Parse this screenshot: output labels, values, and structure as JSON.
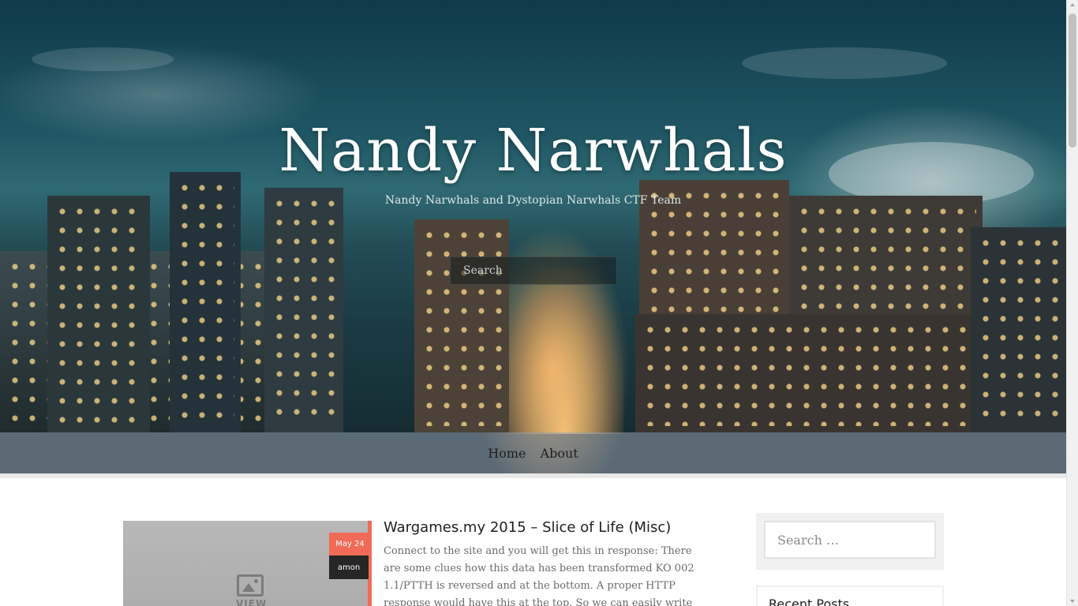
{
  "site": {
    "title": "Nandy Narwhals",
    "tagline": "Nandy Narwhals and Dystopian Narwhals CTF Team",
    "search_placeholder": "Search"
  },
  "nav": {
    "items": [
      {
        "label": "Home"
      },
      {
        "label": "About"
      }
    ]
  },
  "post": {
    "date": "May 24",
    "author": "amon",
    "title": "Wargames.my 2015 – Slice of Life (Misc)",
    "excerpt": "Connect to the site and you will get this in response: There are some clues how this data has been transformed KO 002 1.1/PTTH is reversed and at the bottom. A proper HTTP response would have this at the top. So we can easily write",
    "thumbnail_label": "VIEW"
  },
  "sidebar": {
    "search_placeholder": "Search …",
    "recent_posts_title": "Recent Posts"
  },
  "colors": {
    "accent": "#ef6b57",
    "dark_badge": "#262626"
  }
}
